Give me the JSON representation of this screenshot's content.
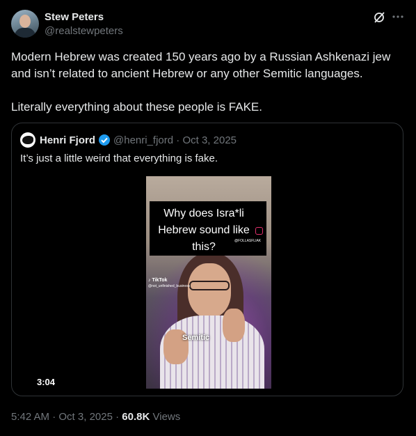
{
  "post": {
    "author_name": "Stew Peters",
    "author_handle": "@realstewpeters",
    "text_p1": "Modern Hebrew was created 150 years ago by a Russian Ashkenazi jew and isn’t related to ancient Hebrew or any other Semitic languages.",
    "text_p2": "Literally everything about these people is FAKE.",
    "time": "5:42 AM",
    "date": "Oct 3, 2025",
    "views_count": "60.8K",
    "views_label": "Views"
  },
  "quote": {
    "author_name": "Henri Fjord",
    "author_handle": "@henri_fjord",
    "date": "Oct 3, 2025",
    "text": "It’s just a little weird that everything is fake.",
    "video": {
      "caption": "Why does Isra*li Hebrew sound like this?",
      "tiny_handle": "@FOLLASFLIAK",
      "watermark_brand": "TikTok",
      "watermark_user": "@not_unfinished_business",
      "overlay_word": "Semitic",
      "duration": "3:04"
    }
  },
  "colors": {
    "background": "#000000",
    "text_primary": "#e7e9ea",
    "text_secondary": "#71767b",
    "border": "#2f3336",
    "verified": "#1d9bf0"
  },
  "icons": [
    "grok-icon",
    "more-icon",
    "verified-icon",
    "tiktok-icon",
    "instagram-icon"
  ]
}
